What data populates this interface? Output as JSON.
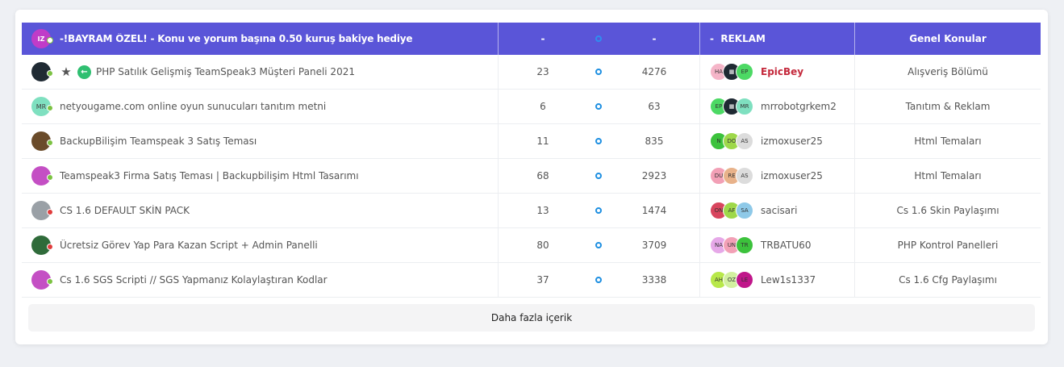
{
  "header": {
    "avatar_initials": "IZ",
    "title": "-!BAYRAM ÖZEL! - Konu ve yorum başına 0.50 kuruş bakiye hediye",
    "col_replies": "-",
    "col_views": "-",
    "col_last": "-  REKLAM",
    "col_forum": "Genel Konular"
  },
  "rows": [
    {
      "initials": "",
      "avatar_color": "#1f2a33",
      "status": "online",
      "star": true,
      "arrow": true,
      "title": "PHP Satılık Gelişmiş TeamSpeak3 Müşteri Paneli 2021",
      "replies": "23",
      "views": "4276",
      "stack": [
        {
          "t": "HA",
          "c": "#f5b5c8"
        },
        {
          "t": "▦",
          "c": "#1f2a33"
        },
        {
          "t": "EP",
          "c": "#4cd964"
        }
      ],
      "user": "EpicBey",
      "user_highlight": true,
      "forum": "Alışveriş Bölümü"
    },
    {
      "initials": "MR",
      "avatar_color": "#7fe0c0",
      "status": "online",
      "star": false,
      "arrow": false,
      "title": "netyougame.com online oyun sunucuları tanıtım metni",
      "replies": "6",
      "views": "63",
      "stack": [
        {
          "t": "EP",
          "c": "#4cd964"
        },
        {
          "t": "▦",
          "c": "#1f2a33"
        },
        {
          "t": "MR",
          "c": "#7fe0c0"
        }
      ],
      "user": "mrrobotgrkem2",
      "user_highlight": false,
      "forum": "Tanıtım & Reklam"
    },
    {
      "initials": "",
      "avatar_color": "#6a4b2a",
      "status": "online",
      "star": false,
      "arrow": false,
      "title": "BackupBilişim Teamspeak 3 Satış Teması",
      "replies": "11",
      "views": "835",
      "stack": [
        {
          "t": "N",
          "c": "#3cc23c"
        },
        {
          "t": "DO",
          "c": "#9ed84a"
        },
        {
          "t": "AS",
          "c": "#dcdcdc"
        }
      ],
      "user": "izmoxuser25",
      "user_highlight": false,
      "forum": "Html Temaları"
    },
    {
      "initials": "",
      "avatar_color": "#c44fc4",
      "status": "online",
      "star": false,
      "arrow": false,
      "title": "Teamspeak3 Firma Satış Teması | Backupbilişim Html Tasarımı",
      "replies": "68",
      "views": "2923",
      "stack": [
        {
          "t": "DU",
          "c": "#f2a0b6"
        },
        {
          "t": "RE",
          "c": "#e8b28a"
        },
        {
          "t": "AS",
          "c": "#dcdcdc"
        }
      ],
      "user": "izmoxuser25",
      "user_highlight": false,
      "forum": "Html Temaları"
    },
    {
      "initials": "",
      "avatar_color": "#9aa0a6",
      "status": "offline",
      "star": false,
      "arrow": false,
      "title": "CS 1.6 DEFAULT SKİN PACK",
      "replies": "13",
      "views": "1474",
      "stack": [
        {
          "t": "ON",
          "c": "#d8455e"
        },
        {
          "t": "AF",
          "c": "#9ed84a"
        },
        {
          "t": "SA",
          "c": "#8ec9e8"
        }
      ],
      "user": "sacisari",
      "user_highlight": false,
      "forum": "Cs 1.6 Skin Paylaşımı"
    },
    {
      "initials": "",
      "avatar_color": "#2f6b3a",
      "status": "offline",
      "star": false,
      "arrow": false,
      "title": "Ücretsiz Görev Yap Para Kazan Script + Admin Panelli",
      "replies": "80",
      "views": "3709",
      "stack": [
        {
          "t": "NA",
          "c": "#e6a8e8"
        },
        {
          "t": "UN",
          "c": "#f2a0b6"
        },
        {
          "t": "TR",
          "c": "#3cc23c"
        }
      ],
      "user": "TRBATU60",
      "user_highlight": false,
      "forum": "PHP Kontrol Panelleri"
    },
    {
      "initials": "",
      "avatar_color": "#c44fc4",
      "status": "online",
      "star": false,
      "arrow": false,
      "title": "Cs 1.6 SGS Scripti // SGS Yapmanız Kolaylaştıran Kodlar",
      "replies": "37",
      "views": "3338",
      "stack": [
        {
          "t": "AH",
          "c": "#b8e84a"
        },
        {
          "t": "OZ",
          "c": "#d2f0a0"
        },
        {
          "t": "LE",
          "c": "#c0168a"
        }
      ],
      "user": "Lew1s1337",
      "user_highlight": false,
      "forum": "Cs 1.6 Cfg Paylaşımı"
    }
  ],
  "more_button": "Daha fazla içerik"
}
